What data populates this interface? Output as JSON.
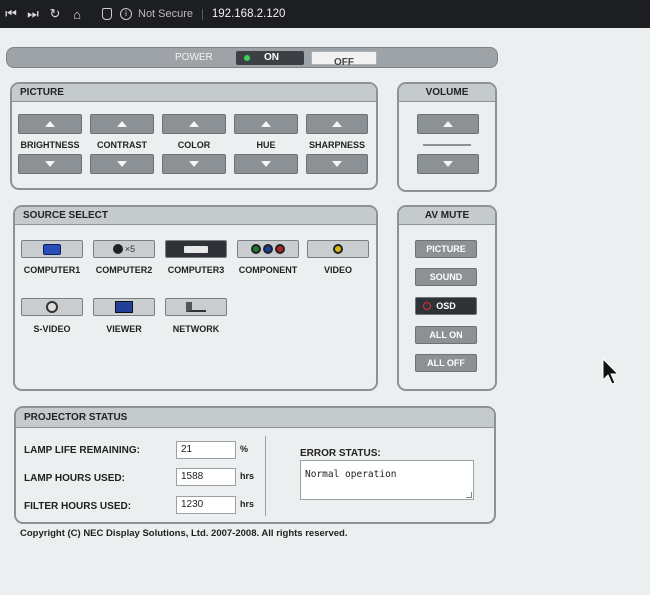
{
  "browser": {
    "security_label": "Not Secure",
    "url": "192.168.2.120"
  },
  "power": {
    "label": "POWER",
    "on_label": "ON",
    "off_label": "OFF"
  },
  "picture": {
    "title": "PICTURE",
    "controls": [
      "BRIGHTNESS",
      "CONTRAST",
      "COLOR",
      "HUE",
      "SHARPNESS"
    ]
  },
  "volume": {
    "title": "VOLUME"
  },
  "source": {
    "title": "SOURCE SELECT",
    "computer2_badge": "×5",
    "items": [
      "COMPUTER1",
      "COMPUTER2",
      "COMPUTER3",
      "COMPONENT",
      "VIDEO",
      "S-VIDEO",
      "VIEWER",
      "NETWORK"
    ],
    "selected": "COMPUTER3"
  },
  "av_mute": {
    "title": "AV MUTE",
    "items": [
      "PICTURE",
      "SOUND",
      "OSD",
      "ALL ON",
      "ALL OFF"
    ],
    "active": "OSD"
  },
  "status": {
    "title": "PROJECTOR STATUS",
    "lamp_life_label": "LAMP LIFE REMAINING:",
    "lamp_life_value": "21",
    "lamp_life_unit": "%",
    "lamp_hours_label": "LAMP HOURS USED:",
    "lamp_hours_value": "1588",
    "lamp_hours_unit": "hrs",
    "filter_hours_label": "FILTER HOURS USED:",
    "filter_hours_value": "1230",
    "filter_hours_unit": "hrs",
    "error_label": "ERROR STATUS:",
    "error_value": "Normal operation"
  },
  "footer": {
    "copyright": "Copyright (C) NEC Display Solutions, Ltd. 2007-2008. All rights reserved."
  },
  "colors": {
    "panel_bg": "#ecefef",
    "header_bg": "#c5cacd",
    "button": "#8c9196",
    "selected": "#2f3236",
    "power_indicator": "#3fcf5a"
  }
}
